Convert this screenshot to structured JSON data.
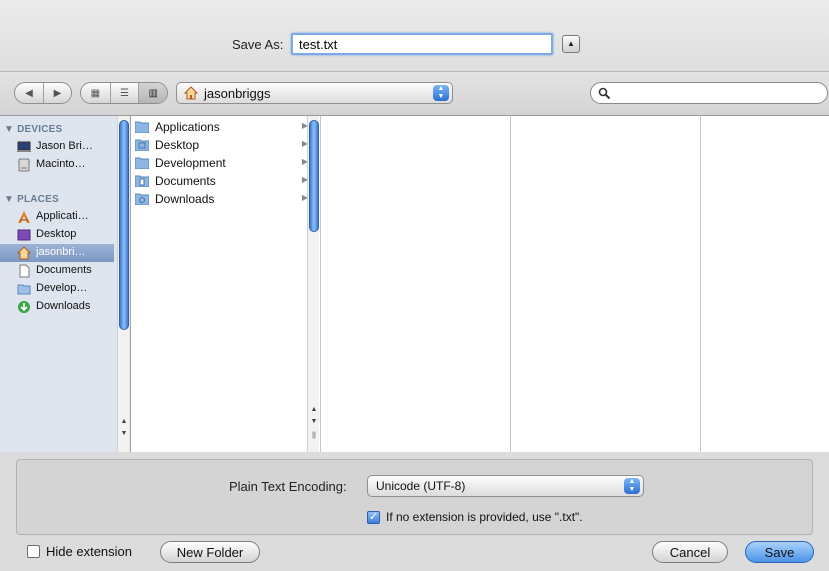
{
  "header": {
    "save_as_label": "Save As:",
    "filename": "test.txt"
  },
  "toolbar": {
    "location": "jasonbriggs",
    "view_modes": [
      "icon",
      "list",
      "column"
    ],
    "active_view": "column"
  },
  "sidebar": {
    "devices_heading": "▼ DEVICES",
    "devices": [
      {
        "label": "Jason Bri…",
        "icon": "computer-icon"
      },
      {
        "label": "Macinto…",
        "icon": "hard-drive-icon"
      }
    ],
    "places_heading": "▼ PLACES",
    "places": [
      {
        "label": "Applicati…",
        "icon": "applications-icon",
        "selected": false
      },
      {
        "label": "Desktop",
        "icon": "desktop-icon",
        "selected": false
      },
      {
        "label": "jasonbri…",
        "icon": "home-icon",
        "selected": true
      },
      {
        "label": "Documents",
        "icon": "document-icon",
        "selected": false
      },
      {
        "label": "Develop…",
        "icon": "folder-icon",
        "selected": false
      },
      {
        "label": "Downloads",
        "icon": "downloads-icon",
        "selected": false
      }
    ]
  },
  "column1": {
    "items": [
      "Applications",
      "Desktop",
      "Development",
      "Documents",
      "Downloads"
    ]
  },
  "options": {
    "encoding_label": "Plain Text Encoding:",
    "encoding_value": "Unicode (UTF-8)",
    "extension_checkbox_label": "If no extension is provided, use \".txt\".",
    "extension_checked": true
  },
  "footer": {
    "hide_extension_label": "Hide extension",
    "hide_extension_checked": false,
    "new_folder": "New Folder",
    "cancel": "Cancel",
    "save": "Save"
  },
  "colors": {
    "accent": "#3c7ed9",
    "sidebar_bg": "#dfe5ee",
    "selection": "#7b97c3"
  }
}
